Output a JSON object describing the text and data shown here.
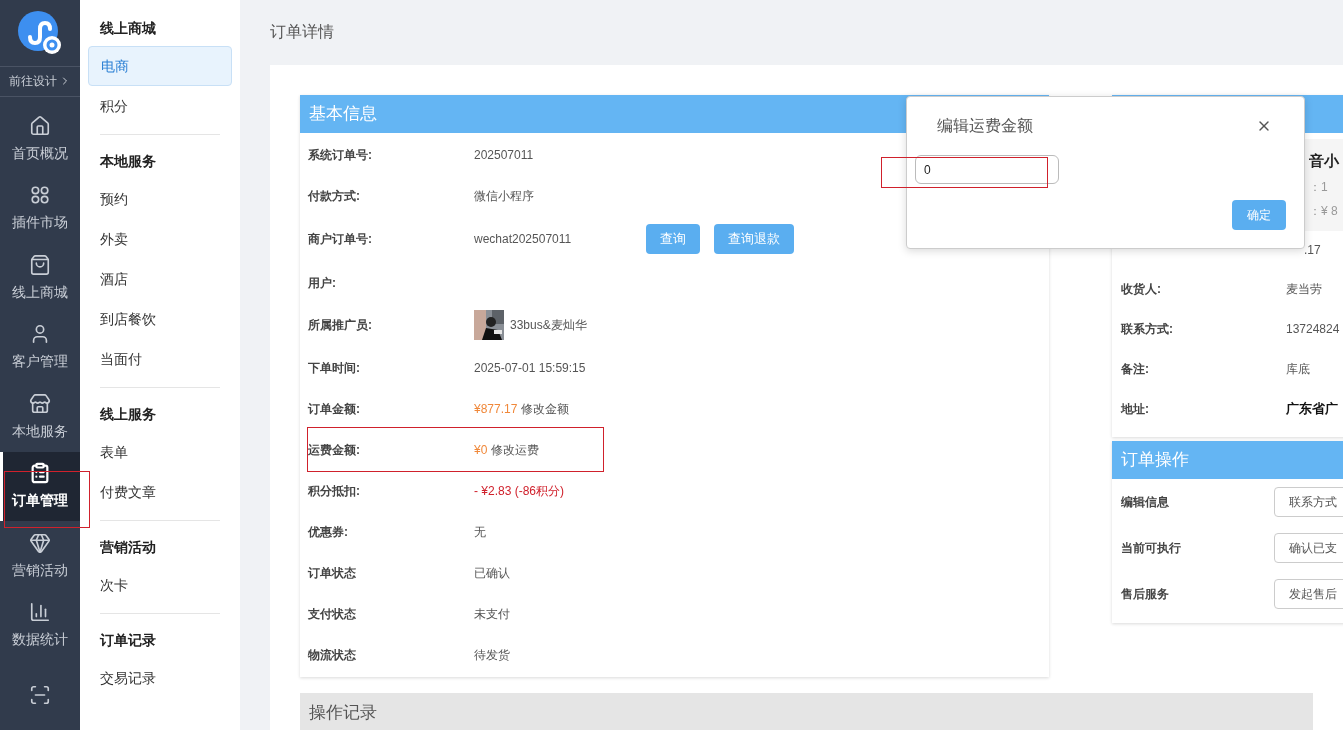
{
  "rail": {
    "design_link": "前往设计",
    "items": [
      {
        "label": "首页概况",
        "selected": false,
        "highlighted": false
      },
      {
        "label": "插件市场",
        "selected": false,
        "highlighted": false
      },
      {
        "label": "线上商城",
        "selected": false,
        "highlighted": false
      },
      {
        "label": "客户管理",
        "selected": false,
        "highlighted": false
      },
      {
        "label": "本地服务",
        "selected": false,
        "highlighted": false
      },
      {
        "label": "订单管理",
        "selected": true,
        "highlighted": true
      },
      {
        "label": "营销活动",
        "selected": false,
        "highlighted": false
      },
      {
        "label": "数据统计",
        "selected": false,
        "highlighted": false
      },
      {
        "selected": false,
        "highlighted": false
      }
    ]
  },
  "submenu": [
    {
      "heading": "线上商城",
      "items": [
        {
          "label": "电商",
          "selected": true
        },
        {
          "label": "积分",
          "selected": false
        }
      ]
    },
    {
      "heading": "本地服务",
      "items": [
        {
          "label": "预约",
          "selected": false
        },
        {
          "label": "外卖",
          "selected": false
        },
        {
          "label": "酒店",
          "selected": false
        },
        {
          "label": "到店餐饮",
          "selected": false
        },
        {
          "label": "当面付",
          "selected": false
        }
      ]
    },
    {
      "heading": "线上服务",
      "items": [
        {
          "label": "表单",
          "selected": false
        },
        {
          "label": "付费文章",
          "selected": false
        }
      ]
    },
    {
      "heading": "营销活动",
      "items": [
        {
          "label": "次卡",
          "selected": false
        }
      ]
    },
    {
      "heading": "订单记录",
      "items": [
        {
          "label": "交易记录",
          "selected": false
        }
      ]
    }
  ],
  "page_title": "订单详情",
  "basic_info": {
    "title": "基本信息",
    "rows": [
      {
        "kind": "text",
        "label": "系统订单号:",
        "value": "202507011",
        "highlighted": false
      },
      {
        "kind": "text",
        "label": "付款方式:",
        "value": "微信小程序",
        "highlighted": false
      },
      {
        "kind": "buttons",
        "label": "商户订单号:",
        "value": "wechat202507011",
        "buttons": [
          "查询",
          "查询退款"
        ],
        "highlighted": false
      },
      {
        "kind": "text",
        "label": "用户:",
        "highlighted": false
      },
      {
        "kind": "avatar",
        "label": "所属推广员:",
        "value": "33bus&麦灿华",
        "highlighted": false
      },
      {
        "kind": "text",
        "label": "下单时间:",
        "value": "2025-07-01 15:59:15",
        "highlighted": false
      },
      {
        "kind": "money",
        "label": "订单金额:",
        "value": "¥877.17",
        "action": "修改金额",
        "highlighted": false
      },
      {
        "kind": "money",
        "label": "运费金额:",
        "value": "¥0",
        "action": "修改运费",
        "highlighted": true
      },
      {
        "kind": "deduction",
        "label": "积分抵扣:",
        "value": "- ¥2.83 (-86积分)",
        "highlighted": false
      },
      {
        "kind": "text",
        "label": "优惠券:",
        "value": "无",
        "highlighted": false
      },
      {
        "kind": "text",
        "label": "订单状态",
        "value": "已确认",
        "highlighted": false
      },
      {
        "kind": "text",
        "label": "支付状态",
        "value": "未支付",
        "highlighted": false
      },
      {
        "kind": "text",
        "label": "物流状态",
        "value": "待发货",
        "highlighted": false
      }
    ]
  },
  "right_panel": {
    "product": {
      "name": "音小",
      "quantity": "：1",
      "price": "：¥ 8"
    },
    "total_partial": ".17",
    "rows": [
      {
        "label": "收货人:",
        "value": "麦当劳",
        "bold": false
      },
      {
        "label": "联系方式:",
        "value": "13724824",
        "bold": false
      },
      {
        "label": "备注:",
        "value": "库底",
        "bold": false
      },
      {
        "label": "地址:",
        "value": "广东省广",
        "bold": true
      }
    ],
    "operations": {
      "title": "订单操作",
      "rows": [
        {
          "label": "编辑信息",
          "button": "联系方式"
        },
        {
          "label": "当前可执行",
          "button": "确认已支"
        },
        {
          "label": "售后服务",
          "button": "发起售后"
        }
      ]
    }
  },
  "log_panel": {
    "title": "操作记录"
  },
  "dialog": {
    "title": "编辑运费金额",
    "value": "0",
    "highlighted": true,
    "confirm": "确定"
  }
}
